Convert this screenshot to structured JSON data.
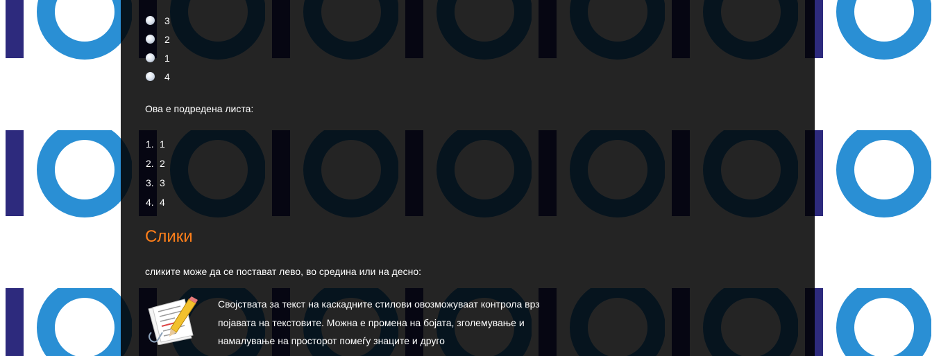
{
  "colors": {
    "page_bg": "#ffffff",
    "pattern_dark_bar": "#2d2a7d",
    "pattern_ring": "#2a8fd4",
    "content_bg": "#222222",
    "heading_accent": "#ff7f1a",
    "text": "#ffffff"
  },
  "bullet_list": {
    "items": [
      "3",
      "2",
      "1",
      "4"
    ],
    "bullet_icon": "sphere-bullet-icon"
  },
  "ordered_intro": "Ова е подредена листа:",
  "ordered_list": {
    "items": [
      {
        "marker": "1.",
        "text": "1"
      },
      {
        "marker": "2.",
        "text": "2"
      },
      {
        "marker": "3.",
        "text": "3"
      },
      {
        "marker": "4.",
        "text": "4"
      }
    ]
  },
  "images_section": {
    "heading": "Слики",
    "intro": "сликите може да се постават лево, во средина или на десно:",
    "image_icon": "document-pencil-icon",
    "paragraph": "Својствата за текст на каскадните стилови овозможуваат контрола врз појавата на текстовите. Можна е промена на бојата, зголемување и намалување на просторот помеѓу знаците и друго"
  }
}
